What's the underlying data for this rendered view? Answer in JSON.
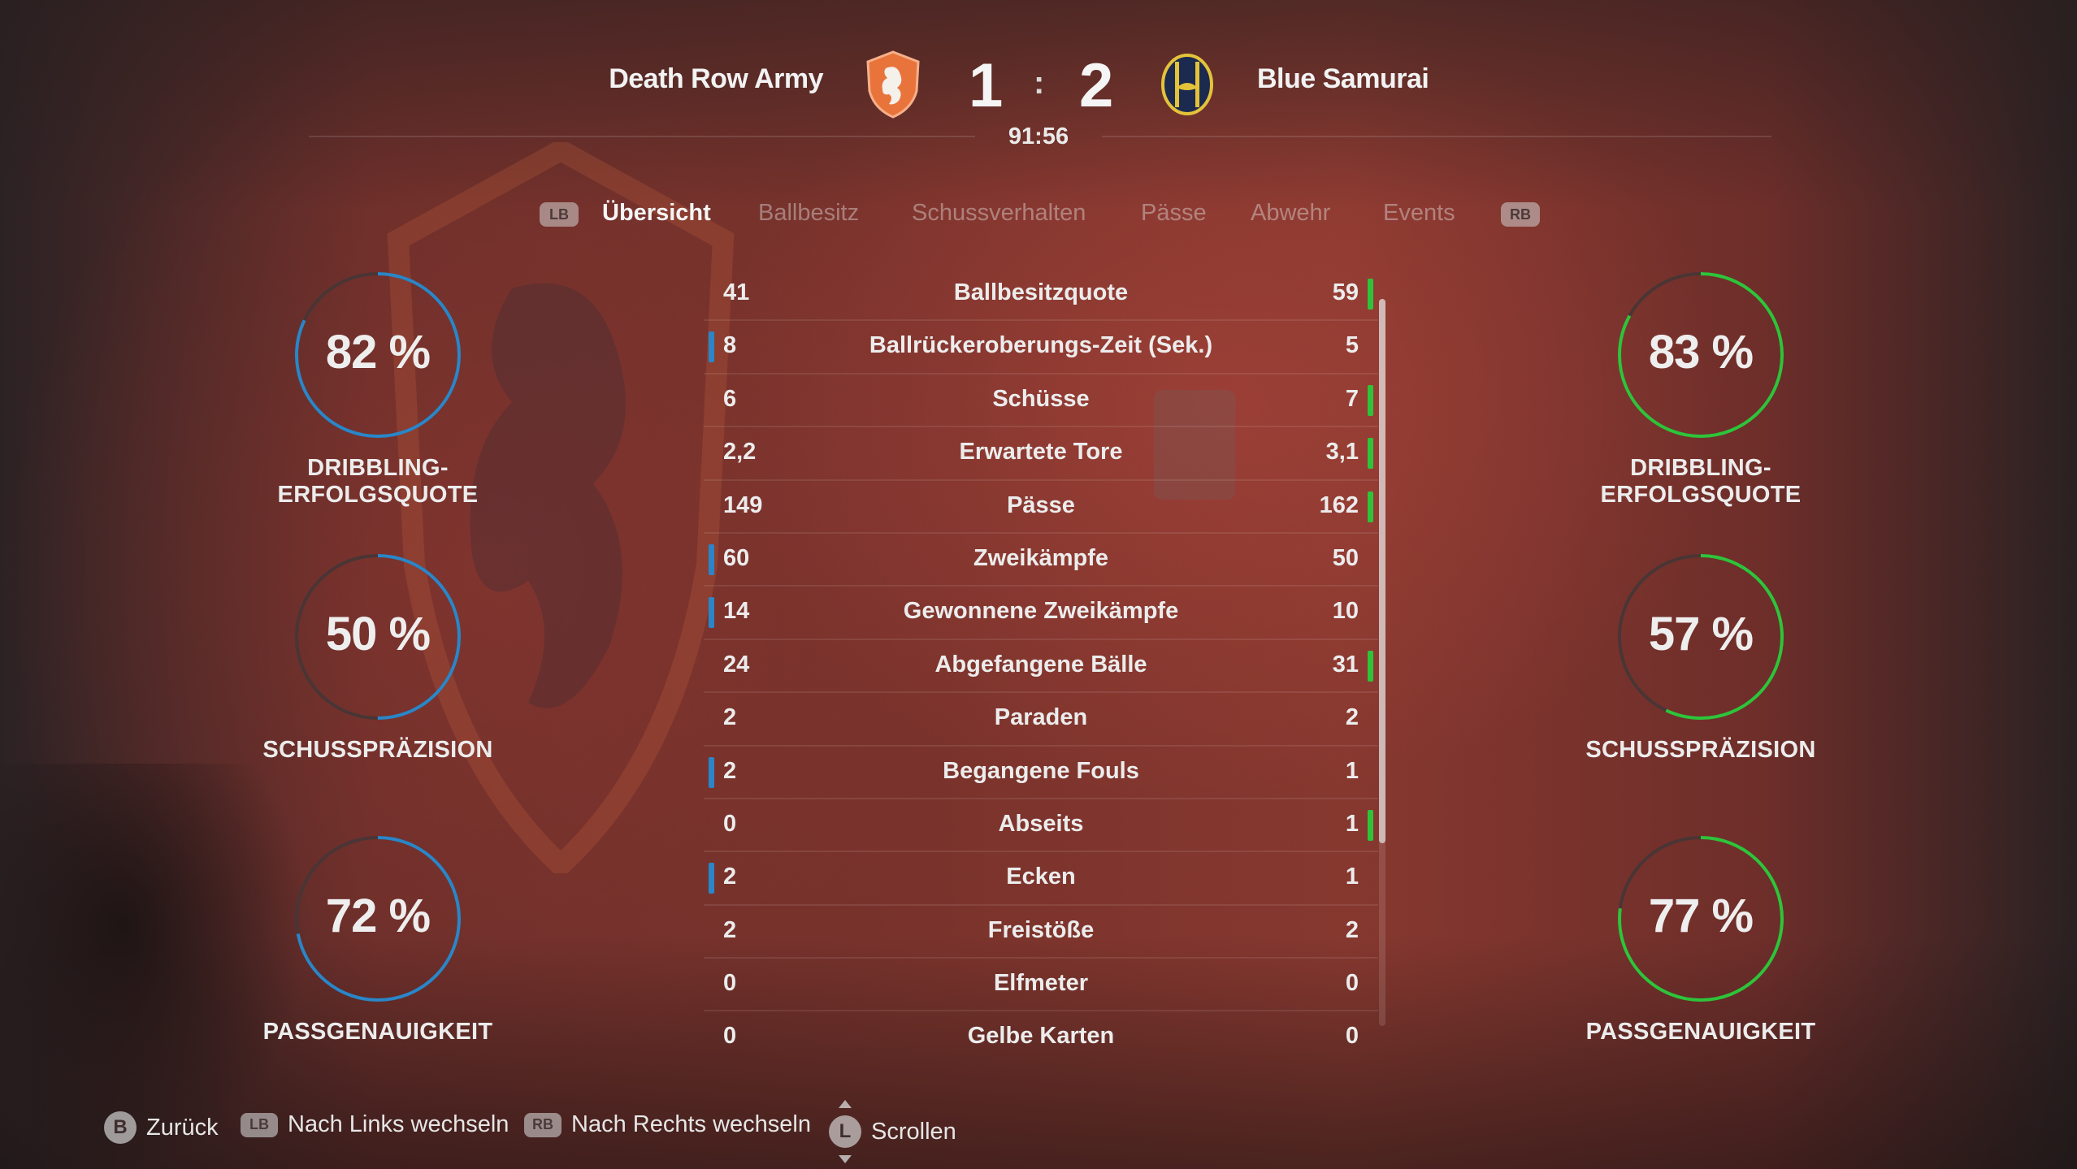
{
  "header": {
    "home_team": "Death Row Army",
    "away_team": "Blue Samurai",
    "home_score": "1",
    "away_score": "2",
    "score_separator": ":",
    "clock": "91:56"
  },
  "tabs": {
    "left_button": "LB",
    "right_button": "RB",
    "items": [
      {
        "label": "Übersicht",
        "active": true
      },
      {
        "label": "Ballbesitz",
        "active": false
      },
      {
        "label": "Schussverhalten",
        "active": false
      },
      {
        "label": "Pässe",
        "active": false
      },
      {
        "label": "Abwehr",
        "active": false
      },
      {
        "label": "Events",
        "active": false
      }
    ]
  },
  "home_gauges": [
    {
      "value": "82 %",
      "fraction": 0.82,
      "label": "DRIBBLING-ERFOLGSQUOTE"
    },
    {
      "value": "50 %",
      "fraction": 0.5,
      "label": "SCHUSSPRÄZISION"
    },
    {
      "value": "72 %",
      "fraction": 0.72,
      "label": "PASSGENAUIGKEIT"
    }
  ],
  "away_gauges": [
    {
      "value": "83 %",
      "fraction": 0.83,
      "label": "DRIBBLING-ERFOLGSQUOTE"
    },
    {
      "value": "57 %",
      "fraction": 0.57,
      "label": "SCHUSSPRÄZISION"
    },
    {
      "value": "77 %",
      "fraction": 0.77,
      "label": "PASSGENAUIGKEIT"
    }
  ],
  "stats": [
    {
      "home": "41",
      "label": "Ballbesitzquote",
      "away": "59",
      "lead": "away"
    },
    {
      "home": "8",
      "label": "Ballrückeroberungs-Zeit (Sek.)",
      "away": "5",
      "lead": "home"
    },
    {
      "home": "6",
      "label": "Schüsse",
      "away": "7",
      "lead": "away"
    },
    {
      "home": "2,2",
      "label": "Erwartete Tore",
      "away": "3,1",
      "lead": "away"
    },
    {
      "home": "149",
      "label": "Pässe",
      "away": "162",
      "lead": "away"
    },
    {
      "home": "60",
      "label": "Zweikämpfe",
      "away": "50",
      "lead": "home"
    },
    {
      "home": "14",
      "label": "Gewonnene Zweikämpfe",
      "away": "10",
      "lead": "home"
    },
    {
      "home": "24",
      "label": "Abgefangene Bälle",
      "away": "31",
      "lead": "away"
    },
    {
      "home": "2",
      "label": "Paraden",
      "away": "2",
      "lead": "none"
    },
    {
      "home": "2",
      "label": "Begangene Fouls",
      "away": "1",
      "lead": "home"
    },
    {
      "home": "0",
      "label": "Abseits",
      "away": "1",
      "lead": "away"
    },
    {
      "home": "2",
      "label": "Ecken",
      "away": "1",
      "lead": "home"
    },
    {
      "home": "2",
      "label": "Freistöße",
      "away": "2",
      "lead": "none"
    },
    {
      "home": "0",
      "label": "Elfmeter",
      "away": "0",
      "lead": "none"
    },
    {
      "home": "0",
      "label": "Gelbe Karten",
      "away": "0",
      "lead": "none"
    }
  ],
  "footer": {
    "back": {
      "button": "B",
      "label": "Zurück"
    },
    "left": {
      "button": "LB",
      "label": "Nach Links wechseln"
    },
    "right": {
      "button": "RB",
      "label": "Nach Rechts wechseln"
    },
    "scroll": {
      "button": "L",
      "label": "Scrollen"
    }
  },
  "colors": {
    "home_accent": "#2a86c8",
    "away_accent": "#2ec43a",
    "gauge_track": "#4a3535"
  }
}
